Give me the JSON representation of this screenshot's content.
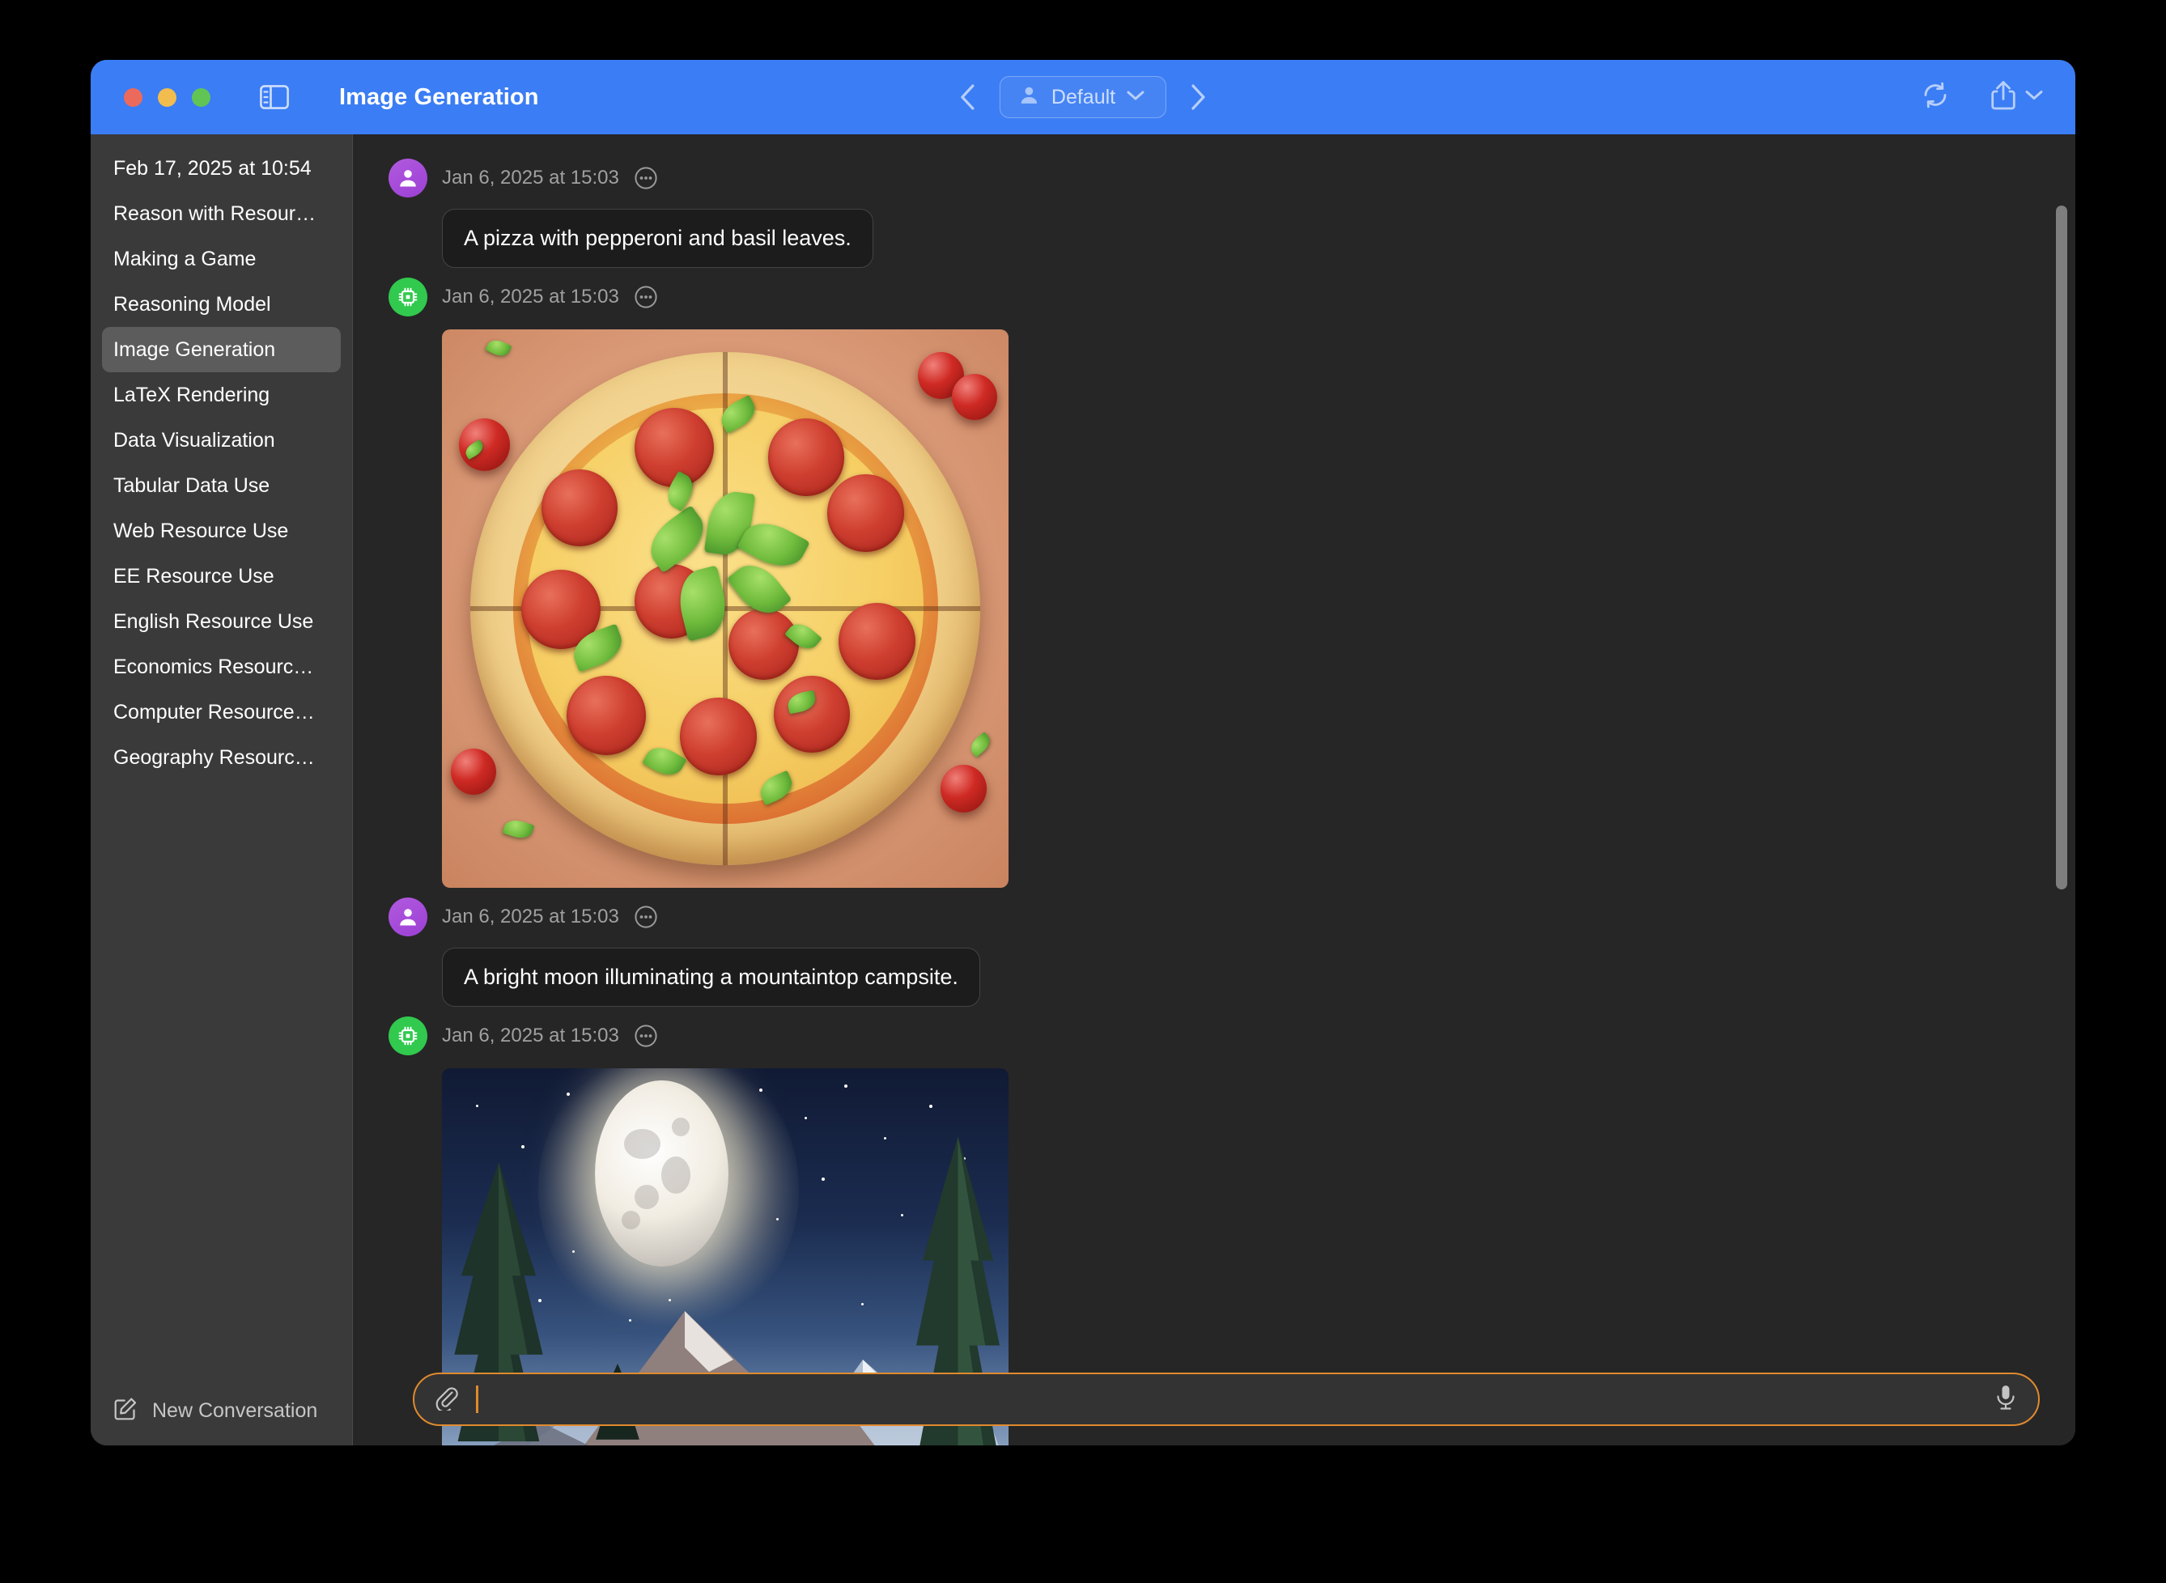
{
  "window": {
    "title": "Image Generation",
    "traffic_lights": [
      "close",
      "minimize",
      "zoom"
    ]
  },
  "toolbar": {
    "sidebar_toggle_icon": "sidebar-toggle-icon",
    "back_icon": "chevron-left-icon",
    "forward_icon": "chevron-right-icon",
    "profile": {
      "icon": "person-icon",
      "label": "Default",
      "chevron": "chevron-down-icon"
    },
    "refresh_icon": "refresh-icon",
    "share_icon": "share-icon",
    "share_chevron_icon": "chevron-down-icon"
  },
  "sidebar": {
    "items": [
      {
        "label": "Feb 17, 2025 at 10:54",
        "selected": false
      },
      {
        "label": "Reason with Resour…",
        "selected": false
      },
      {
        "label": "Making a Game",
        "selected": false
      },
      {
        "label": "Reasoning Model",
        "selected": false
      },
      {
        "label": "Image Generation",
        "selected": true
      },
      {
        "label": "LaTeX Rendering",
        "selected": false
      },
      {
        "label": "Data Visualization",
        "selected": false
      },
      {
        "label": "Tabular Data Use",
        "selected": false
      },
      {
        "label": "Web Resource Use",
        "selected": false
      },
      {
        "label": "EE Resource Use",
        "selected": false
      },
      {
        "label": "English Resource Use",
        "selected": false
      },
      {
        "label": "Economics Resourc…",
        "selected": false
      },
      {
        "label": "Computer Resource…",
        "selected": false
      },
      {
        "label": "Geography Resourc…",
        "selected": false
      }
    ],
    "new_conversation": {
      "label": "New Conversation",
      "icon": "compose-icon"
    }
  },
  "chat": {
    "messages": [
      {
        "role": "user",
        "avatar_icon": "person-icon",
        "timestamp": "Jan 6, 2025 at 15:03",
        "options_icon": "ellipsis-icon",
        "text": "A pizza with pepperoni and basil leaves."
      },
      {
        "role": "assistant",
        "avatar_icon": "chip-icon",
        "timestamp": "Jan 6, 2025 at 15:03",
        "options_icon": "ellipsis-icon",
        "image_alt": "Top-down pepperoni pizza with basil leaves and cherry tomatoes"
      },
      {
        "role": "user",
        "avatar_icon": "person-icon",
        "timestamp": "Jan 6, 2025 at 15:03",
        "options_icon": "ellipsis-icon",
        "text": "A bright moon illuminating a mountaintop campsite."
      },
      {
        "role": "assistant",
        "avatar_icon": "chip-icon",
        "timestamp": "Jan 6, 2025 at 15:03",
        "options_icon": "ellipsis-icon",
        "image_alt": "Full moon over snowy mountain peaks framed by pine trees"
      }
    ]
  },
  "composer": {
    "attach_icon": "paperclip-icon",
    "value": "",
    "placeholder": "",
    "mic_icon": "microphone-icon",
    "focus_color": "#e08a2e"
  },
  "colors": {
    "titlebar": "#3b7df4",
    "sidebar": "#3a3a3a",
    "sidebar_selected": "#5c5c5c",
    "chat_background": "#262626",
    "bubble": "#1c1c1c",
    "user_avatar": "#a64ad6",
    "assistant_avatar": "#31c94e",
    "accent_orange": "#e08a2e"
  }
}
